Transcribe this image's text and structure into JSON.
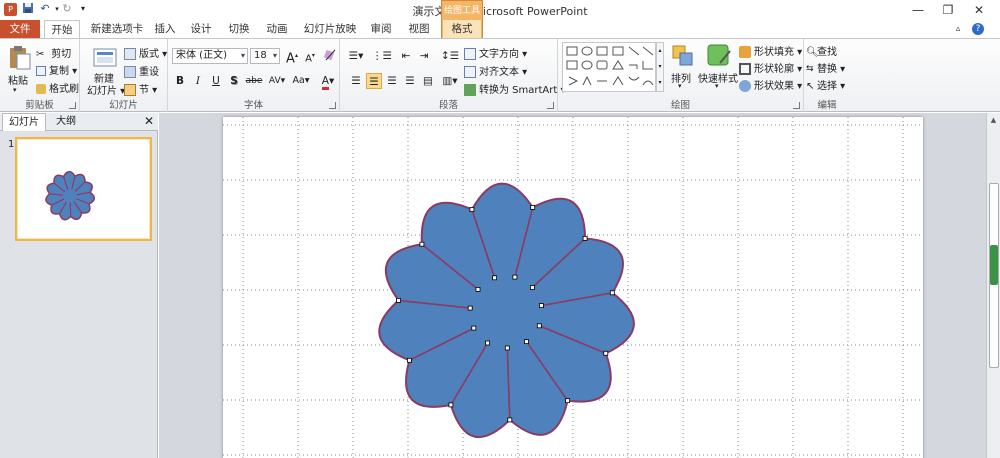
{
  "window": {
    "title_doc": "演示文稿1",
    "title_sep": "-",
    "title_app": "Microsoft PowerPoint",
    "help_glyph": "?"
  },
  "tabs": {
    "file": "文件",
    "home": "开始",
    "new_tab": "新建选项卡",
    "insert": "插入",
    "design": "设计",
    "transitions": "切换",
    "animations": "动画",
    "slideshow": "幻灯片放映",
    "review": "审阅",
    "view": "视图",
    "context_group": "绘图工具",
    "format": "格式"
  },
  "clipboard": {
    "paste": "粘贴",
    "cut": "剪切",
    "copy": "复制",
    "painter": "格式刷",
    "label": "剪贴板"
  },
  "slides_group": {
    "new_slide_1": "新建",
    "new_slide_2": "幻灯片",
    "layout": "版式",
    "reset": "重设",
    "section": "节",
    "label": "幻灯片"
  },
  "font_group": {
    "font_name": "宋体 (正文)",
    "font_size": "18",
    "grow": "A",
    "shrink": "A",
    "bold": "B",
    "italic": "I",
    "underline": "U",
    "shadow": "S",
    "strike": "abe",
    "spacing": "AV",
    "case": "Aa",
    "color": "A",
    "label": "字体"
  },
  "paragraph_group": {
    "text_direction": "文字方向",
    "align_text": "对齐文本",
    "smartart": "转换为 SmartArt",
    "label": "段落"
  },
  "drawing_group": {
    "arrange": "排列",
    "quick_styles": "快速样式",
    "fill": "形状填充",
    "outline": "形状轮廓",
    "effects": "形状效果",
    "label": "绘图"
  },
  "editing_group": {
    "find": "查找",
    "replace": "替换",
    "select": "选择",
    "label": "编辑"
  },
  "left_panel": {
    "tab_slides": "幻灯片",
    "tab_outline": "大纲",
    "close_glyph": "✕",
    "slide_number": "1"
  },
  "colors": {
    "shape_fill": "#4f81bd",
    "shape_outline": "#8b3a62",
    "file_tab": "#c8502d",
    "context_tab": "#f6b466"
  },
  "icons": [
    "save-icon",
    "undo-icon",
    "redo-icon",
    "paste-icon",
    "cut-icon",
    "copy-icon",
    "format-painter-icon",
    "new-slide-icon",
    "layout-icon",
    "reset-icon",
    "section-icon",
    "bullets-icon",
    "numbering-icon",
    "align-left-icon",
    "align-center-icon",
    "align-right-icon",
    "justify-icon",
    "columns-icon",
    "shapes-gallery-icon",
    "arrange-icon",
    "quick-styles-icon",
    "fill-icon",
    "outline-icon",
    "effects-icon",
    "find-icon",
    "replace-icon",
    "select-icon",
    "minimize-icon",
    "restore-icon",
    "close-icon",
    "help-icon"
  ]
}
